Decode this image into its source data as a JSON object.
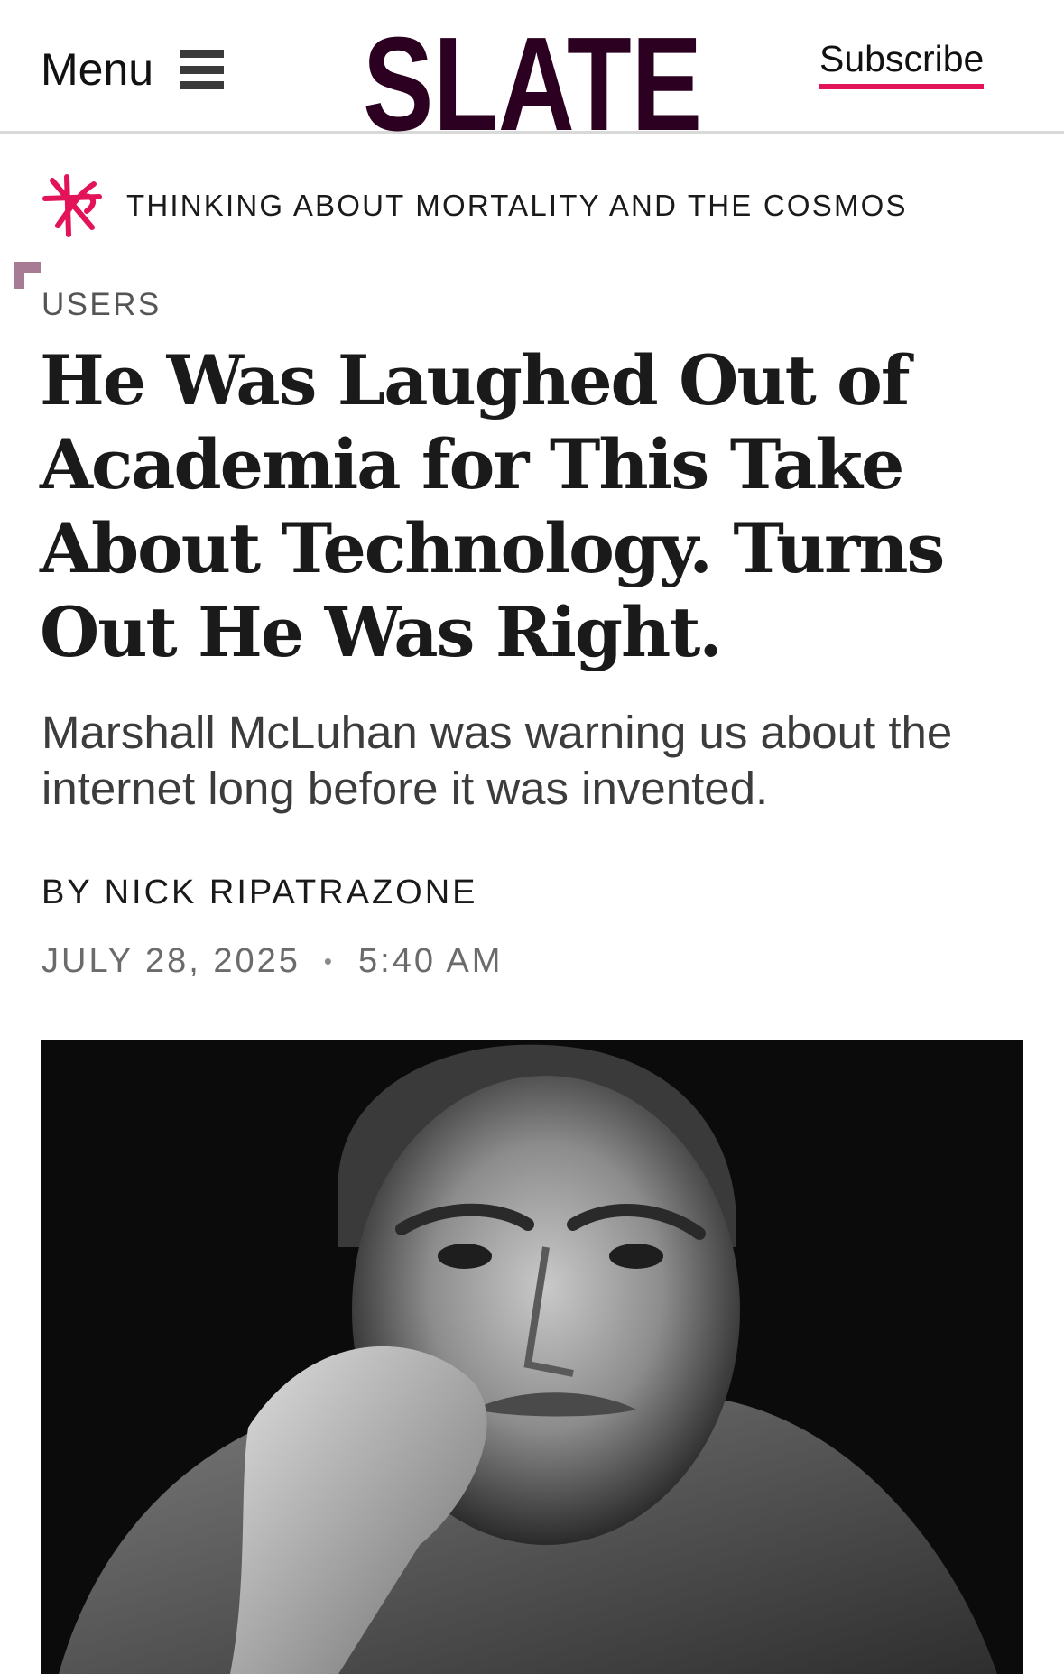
{
  "header": {
    "menu_label": "Menu",
    "logo_text": "SLATE",
    "subscribe_label": "Subscribe",
    "accent_color": "#e3135a",
    "logo_color": "#2c0021"
  },
  "series": {
    "label": "THINKING ABOUT MORTALITY AND THE COSMOS",
    "icon": "series-star-icon"
  },
  "article": {
    "section": "USERS",
    "headline": "He Was Laughed Out of Academia for This Take About Technology. Turns Out He Was Right.",
    "dek": "Marshall McLuhan was warning us about the internet long before it was invented.",
    "byline": "BY NICK RIPATRAZONE",
    "date": "JULY 28, 2025",
    "date_separator": "•",
    "time": "5:40 AM"
  }
}
